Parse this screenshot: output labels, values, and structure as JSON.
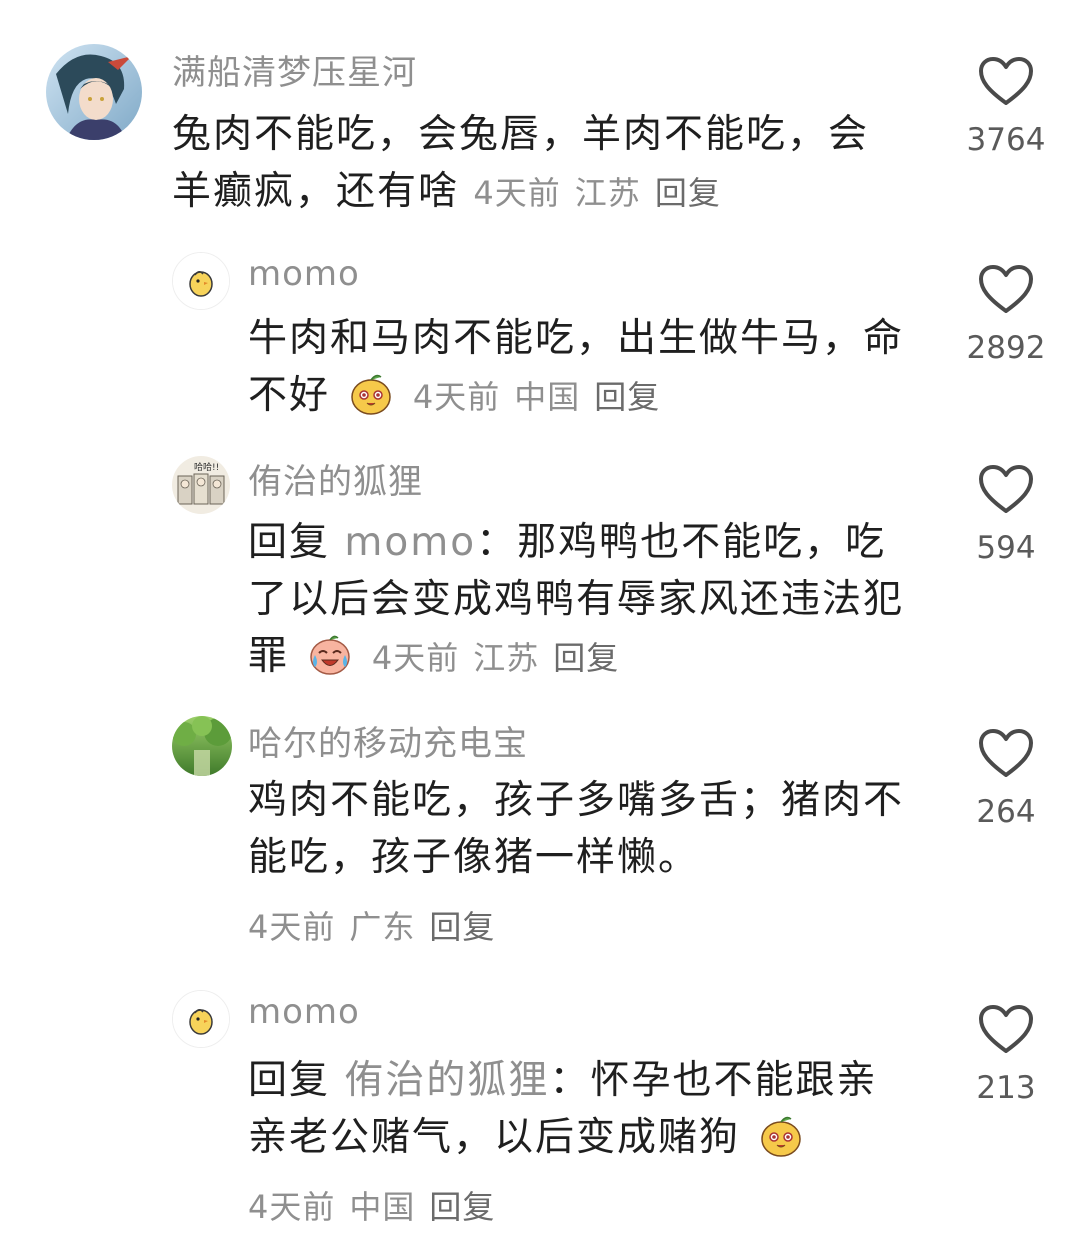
{
  "comments": [
    {
      "username": "满船清梦压星河",
      "text": "兔肉不能吃，会兔唇，羊肉不能吃，会羊癫疯，还有啥",
      "time": "4天前",
      "location": "江苏",
      "reply_label": "回复",
      "likes": "3764",
      "avatar_icon": "anime-character-avatar"
    },
    {
      "username": "momo",
      "text": "牛肉和马肉不能吃，出生做牛马，命不好",
      "emoji": "cute-face-emoji",
      "time": "4天前",
      "location": "中国",
      "reply_label": "回复",
      "likes": "2892",
      "avatar_icon": "chick-avatar"
    },
    {
      "username": "侑治的狐狸",
      "reply_prefix": "回复",
      "mention": "momo",
      "text": "：那鸡鸭也不能吃，吃了以后会变成鸡鸭有辱家风还违法犯罪",
      "emoji": "laugh-cry-emoji",
      "time": "4天前",
      "location": "江苏",
      "reply_label": "回复",
      "likes": "594",
      "avatar_icon": "comic-avatar",
      "avatar_caption": "哈哈!!"
    },
    {
      "username": "哈尔的移动充电宝",
      "text": "鸡肉不能吃，孩子多嘴多舌；猪肉不能吃，孩子像猪一样懒。",
      "time": "4天前",
      "location": "广东",
      "reply_label": "回复",
      "likes": "264",
      "avatar_icon": "forest-avatar"
    },
    {
      "username": "momo",
      "reply_prefix": "回复",
      "mention": "侑治的狐狸",
      "text": "：怀孕也不能跟亲亲老公赌气，以后变成赌狗",
      "emoji": "cute-face-emoji",
      "time": "4天前",
      "location": "中国",
      "reply_label": "回复",
      "likes": "213",
      "avatar_icon": "chick-avatar"
    }
  ],
  "colors": {
    "username": "#8f8f8f",
    "text": "#1f1f1f",
    "meta": "#8f8f8f",
    "heart_stroke": "#4a4a4a"
  }
}
